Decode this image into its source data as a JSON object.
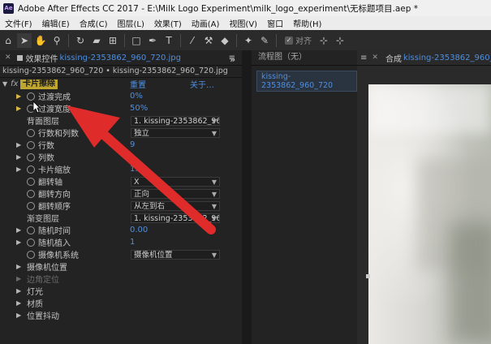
{
  "titlebar": {
    "logo": "Ae",
    "title": "Adobe After Effects CC 2017 - E:\\Milk Logo Experiment\\milk_logo_experiment\\无标题项目.aep *"
  },
  "menubar": {
    "items": [
      "文件(F)",
      "编辑(E)",
      "合成(C)",
      "图层(L)",
      "效果(T)",
      "动画(A)",
      "视图(V)",
      "窗口",
      "帮助(H)"
    ]
  },
  "toolbar": {
    "snap_label": "对齐"
  },
  "effect_controls": {
    "tab_label": "效果控件",
    "tab_layer": "kissing-2353862_960_720.jpg",
    "breadcrumb": "kissing-2353862_960_720 • kissing-2353862_960_720.jpg",
    "effect_name": "卡片擦除",
    "reset_label": "重置",
    "about_label": "关于…",
    "rows": [
      {
        "name": "过渡完成",
        "value": "0%"
      },
      {
        "name": "过渡宽度",
        "value": "50%"
      },
      {
        "name": "背面图层",
        "dropdown": "1. kissing-2353862_960"
      },
      {
        "name": "行数和列数",
        "dropdown": "独立"
      },
      {
        "name": "行数",
        "value": "9"
      },
      {
        "name": "列数",
        "value": ""
      },
      {
        "name": "卡片缩放",
        "value": "1.00"
      },
      {
        "name": "翻转轴",
        "dropdown": "X"
      },
      {
        "name": "翻转方向",
        "dropdown": "正向"
      },
      {
        "name": "翻转顺序",
        "dropdown": "从左到右"
      },
      {
        "name": "渐变图层",
        "dropdown": "1. kissing-2353862_960"
      },
      {
        "name": "随机时间",
        "value": "0.00"
      },
      {
        "name": "随机植入",
        "value": "1"
      },
      {
        "name": "摄像机系统",
        "dropdown": "摄像机位置"
      },
      {
        "name": "摄像机位置"
      },
      {
        "name": "边角定位"
      },
      {
        "name": "灯光"
      },
      {
        "name": "材质"
      },
      {
        "name": "位置抖动"
      }
    ]
  },
  "flowchart": {
    "tab_label": "流程图（无）",
    "chip": "kissing-2353862_960_720"
  },
  "composition": {
    "tab_label": "合成",
    "tab_layer": "kissing-2353862_960_720"
  },
  "colors": {
    "accent": "#4e8fe0",
    "effect_highlight": "#bfa72f",
    "arrow": "#e02b2b"
  }
}
